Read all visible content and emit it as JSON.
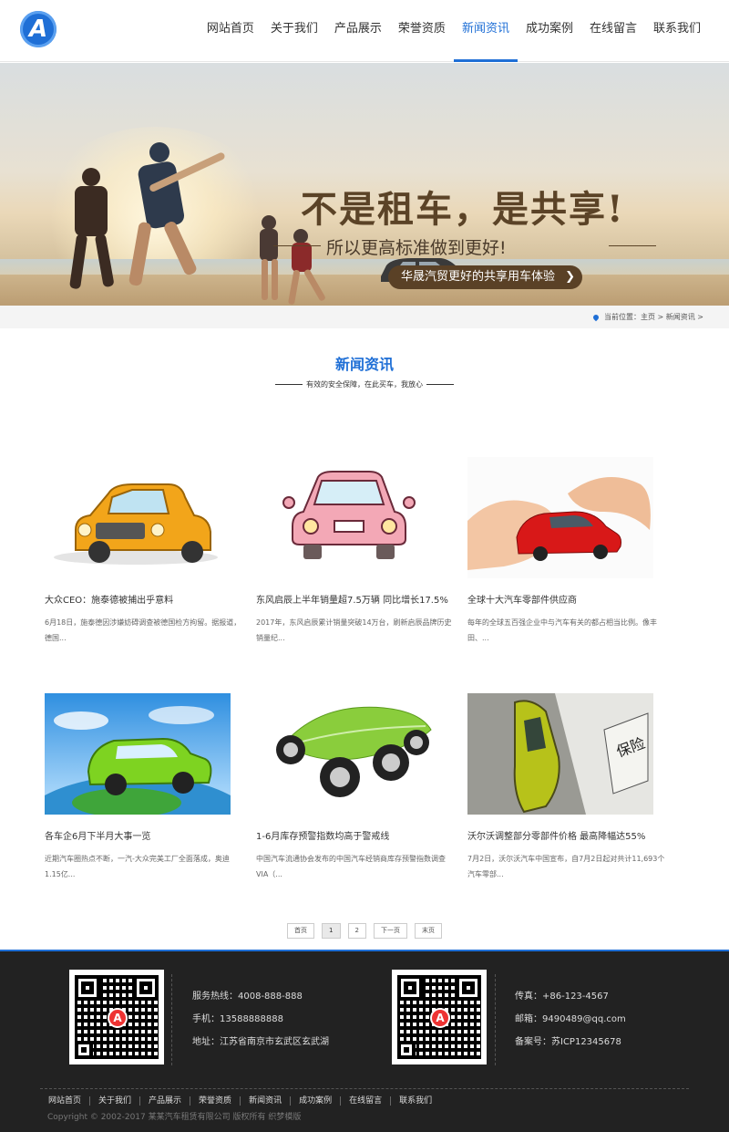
{
  "header": {
    "logo_letter": "A",
    "nav": [
      {
        "label": "网站首页"
      },
      {
        "label": "关于我们"
      },
      {
        "label": "产品展示"
      },
      {
        "label": "荣誉资质"
      },
      {
        "label": "新闻资讯",
        "active": true
      },
      {
        "label": "成功案例"
      },
      {
        "label": "在线留言"
      },
      {
        "label": "联系我们"
      }
    ]
  },
  "banner": {
    "headline": "不是租车，是共享!",
    "subline": "所以更高标准做到更好!",
    "slogan": "华晟汽贸更好的共享用车体验",
    "slogan_arrow": "❯"
  },
  "breadcrumb": {
    "text": "当前位置：主页 > 新闻资讯 >"
  },
  "section": {
    "title": "新闻资讯",
    "subtitle": "有效的安全保障，在此买车，我放心"
  },
  "news": [
    {
      "title": "大众CEO：施泰德被捕出乎意料",
      "desc": "6月18日，施泰德因涉嫌妨碍调查被德国检方拘留。据报道，德国..."
    },
    {
      "title": "东风启辰上半年销量超7.5万辆 同比增长17.5%",
      "desc": "2017年，东风启辰累计销量突破14万台，刷新启辰品牌历史销量纪..."
    },
    {
      "title": "全球十大汽车零部件供应商",
      "desc": "每年的全球五百强企业中与汽车有关的都占相当比例。像丰田、..."
    },
    {
      "title": "各车企6月下半月大事一览",
      "desc": "近期汽车圈热点不断，一汽-大众完美工厂全面落成，奥迪1.15亿..."
    },
    {
      "title": "1-6月库存预警指数均高于警戒线",
      "desc": "中国汽车流通协会发布的中国汽车经销商库存预警指数调查VIA（..."
    },
    {
      "title": "沃尔沃调整部分零部件价格 最高降幅达55%",
      "desc": "7月2日，沃尔沃汽车中国宣布，自7月2日起对共计11,693个汽车零部..."
    }
  ],
  "pager": {
    "first": "首页",
    "pages": [
      "1",
      "2"
    ],
    "current": "1",
    "next": "下一页",
    "last": "末页"
  },
  "footer": {
    "hotline": "服务热线：4008-888-888",
    "mobile": "手机：13588888888",
    "address": "地址：江苏省南京市玄武区玄武湖",
    "fax": "传真：+86-123-4567",
    "email": "邮箱：9490489@qq.com",
    "icp": "备案号：苏ICP12345678",
    "qr_logo": "A",
    "nav": [
      "网站首页",
      "关于我们",
      "产品展示",
      "荣誉资质",
      "新闻资讯",
      "成功案例",
      "在线留言",
      "联系我们"
    ],
    "copyright": "Copyright © 2002-2017 某某汽车租赁有限公司 版权所有 织梦模版"
  },
  "colors": {
    "accent": "#1f6fd6",
    "footer_bg": "#222222",
    "banner_text": "#5b4327"
  }
}
